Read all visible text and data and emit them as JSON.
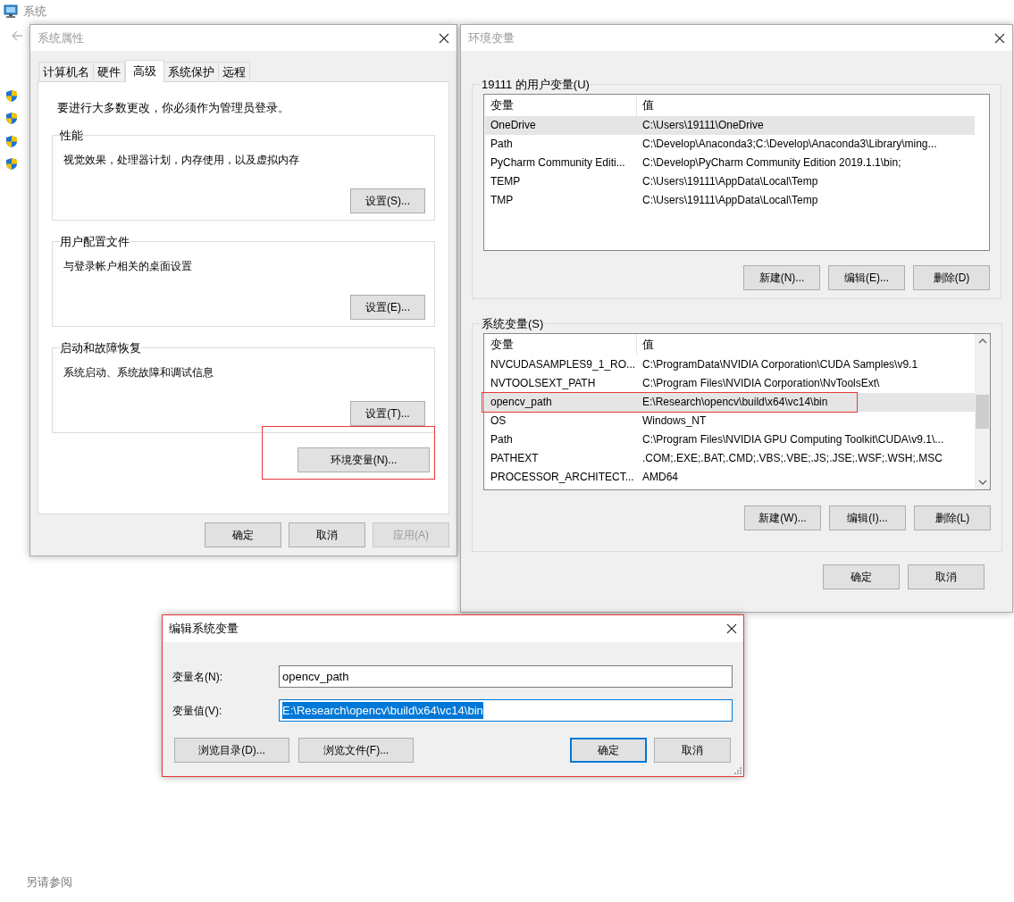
{
  "background_window": {
    "title": "系统",
    "see_also": "另请参阅"
  },
  "system_properties": {
    "title": "系统属性",
    "tabs": [
      {
        "label": "计算机名",
        "selected": false
      },
      {
        "label": "硬件",
        "selected": false
      },
      {
        "label": "高级",
        "selected": true
      },
      {
        "label": "系统保护",
        "selected": false
      },
      {
        "label": "远程",
        "selected": false
      }
    ],
    "notice": "要进行大多数更改，你必须作为管理员登录。",
    "groups": [
      {
        "title": "性能",
        "description": "视觉效果，处理器计划，内存使用，以及虚拟内存",
        "button": "设置(S)..."
      },
      {
        "title": "用户配置文件",
        "description": "与登录帐户相关的桌面设置",
        "button": "设置(E)..."
      },
      {
        "title": "启动和故障恢复",
        "description": "系统启动、系统故障和调试信息",
        "button": "设置(T)..."
      }
    ],
    "env_button": {
      "label": "环境变量(N)...",
      "highlighted": true
    },
    "buttons": [
      {
        "label": "确定",
        "disabled": false
      },
      {
        "label": "取消",
        "disabled": false
      },
      {
        "label": "应用(A)",
        "disabled": true
      }
    ]
  },
  "environment_variables": {
    "title": "环境变量",
    "user_group_title": "19111 的用户变量(U)",
    "user_columns": [
      "变量",
      "值"
    ],
    "user_rows": [
      {
        "name": "OneDrive",
        "value": "C:\\Users\\19111\\OneDrive",
        "selected": true
      },
      {
        "name": "Path",
        "value": "C:\\Develop\\Anaconda3;C:\\Develop\\Anaconda3\\Library\\ming...",
        "selected": false
      },
      {
        "name": "PyCharm Community Editi...",
        "value": "C:\\Develop\\PyCharm Community Edition 2019.1.1\\bin;",
        "selected": false
      },
      {
        "name": "TEMP",
        "value": "C:\\Users\\19111\\AppData\\Local\\Temp",
        "selected": false
      },
      {
        "name": "TMP",
        "value": "C:\\Users\\19111\\AppData\\Local\\Temp",
        "selected": false
      }
    ],
    "user_buttons": [
      "新建(N)...",
      "编辑(E)...",
      "删除(D)"
    ],
    "system_group_title": "系统变量(S)",
    "system_columns": [
      "变量",
      "值"
    ],
    "system_rows": [
      {
        "name": "NVCUDASAMPLES9_1_RO...",
        "value": "C:\\ProgramData\\NVIDIA Corporation\\CUDA Samples\\v9.1",
        "selected": false,
        "highlighted": false
      },
      {
        "name": "NVTOOLSEXT_PATH",
        "value": "C:\\Program Files\\NVIDIA Corporation\\NvToolsExt\\",
        "selected": false,
        "highlighted": false
      },
      {
        "name": "opencv_path",
        "value": "E:\\Research\\opencv\\build\\x64\\vc14\\bin",
        "selected": true,
        "highlighted": true
      },
      {
        "name": "OS",
        "value": "Windows_NT",
        "selected": false,
        "highlighted": false
      },
      {
        "name": "Path",
        "value": "C:\\Program Files\\NVIDIA GPU Computing Toolkit\\CUDA\\v9.1\\...",
        "selected": false,
        "highlighted": false
      },
      {
        "name": "PATHEXT",
        "value": ".COM;.EXE;.BAT;.CMD;.VBS;.VBE;.JS;.JSE;.WSF;.WSH;.MSC",
        "selected": false,
        "highlighted": false
      },
      {
        "name": "PROCESSOR_ARCHITECT...",
        "value": "AMD64",
        "selected": false,
        "highlighted": false
      }
    ],
    "system_buttons": [
      "新建(W)...",
      "编辑(I)...",
      "删除(L)"
    ],
    "buttons": [
      "确定",
      "取消"
    ]
  },
  "edit_dialog": {
    "title": "编辑系统变量",
    "highlighted": true,
    "name_label": "变量名(N):",
    "name_value": "opencv_path",
    "value_label": "变量值(V):",
    "value_value": "E:\\Research\\opencv\\build\\x64\\vc14\\bin",
    "value_selected": true,
    "buttons": [
      {
        "label": "浏览目录(D)...",
        "default": false
      },
      {
        "label": "浏览文件(F)...",
        "default": false
      },
      {
        "label": "确定",
        "default": true
      },
      {
        "label": "取消",
        "default": false
      }
    ]
  }
}
